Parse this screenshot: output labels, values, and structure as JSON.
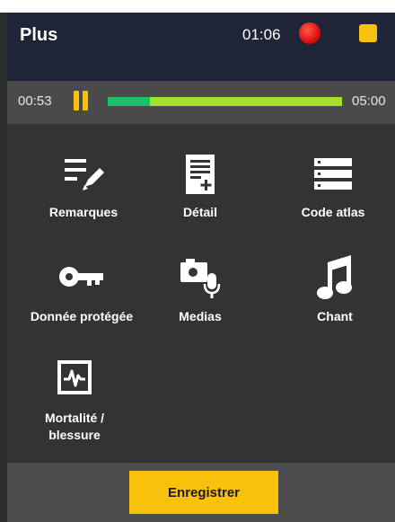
{
  "header": {
    "title": "Plus",
    "timer": "01:06"
  },
  "progress": {
    "elapsed": "00:53",
    "total": "05:00",
    "fraction": 0.18
  },
  "menu": {
    "items": [
      {
        "label": "Remarques",
        "icon": "notes-edit-icon"
      },
      {
        "label": "Détail",
        "icon": "document-add-icon"
      },
      {
        "label": "Code atlas",
        "icon": "list-icon"
      },
      {
        "label": "Donnée protégée",
        "icon": "key-icon"
      },
      {
        "label": "Medias",
        "icon": "camera-mic-icon"
      },
      {
        "label": "Chant",
        "icon": "music-note-icon"
      },
      {
        "label": "Mortalité /",
        "label2": "blessure",
        "icon": "heart-monitor-icon"
      }
    ]
  },
  "footer": {
    "save_label": "Enregistrer"
  },
  "colors": {
    "accent": "#f8c20c",
    "record": "#e01010",
    "progress_green": "#1bbf6a",
    "progress_lime": "#a6e02a",
    "header_bg": "#1f2436"
  }
}
